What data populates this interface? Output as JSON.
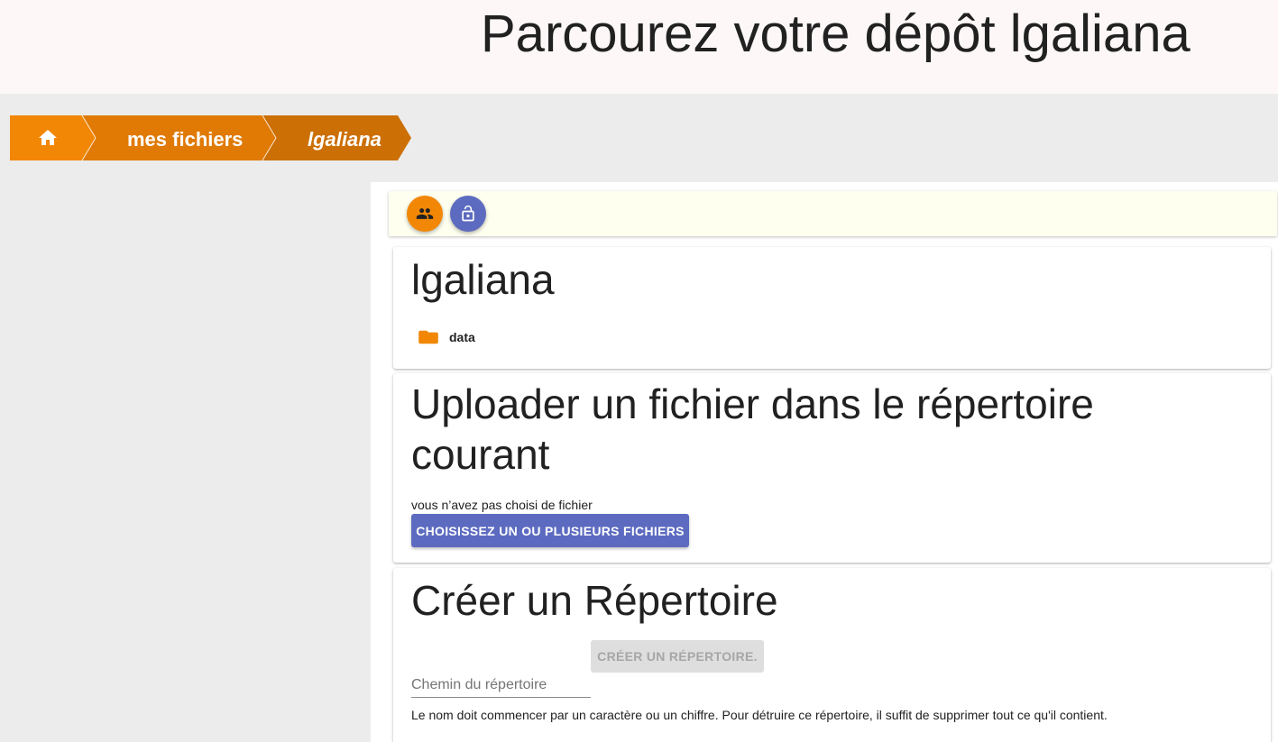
{
  "header": {
    "title": "Parcourez votre dépôt lgaliana"
  },
  "breadcrumb": {
    "home_icon": "home-icon",
    "items": [
      "mes fichiers",
      "lgaliana"
    ],
    "colors": [
      "#f28705",
      "#e07a05",
      "#cc6f04"
    ]
  },
  "toolbar": {
    "buttons": [
      {
        "icon": "people-icon",
        "color": "#f28705"
      },
      {
        "icon": "lock-open-icon",
        "color": "#5c6bc0"
      }
    ]
  },
  "repo": {
    "title": "lgaliana",
    "folders": [
      {
        "name": "data",
        "icon": "folder-icon",
        "color": "#f28705"
      }
    ]
  },
  "upload": {
    "title": "Uploader un fichier dans le répertoire courant",
    "status": "vous n’avez pas choisi de fichier",
    "button_label": "CHOISISSEZ UN OU PLUSIEURS FICHIERS"
  },
  "create_dir": {
    "title": "Créer un Répertoire",
    "button_label": "CRÉER UN RÉPERTOIRE.",
    "input_value": "",
    "input_placeholder": "Chemin du répertoire",
    "help": "Le nom doit commencer par un caractère ou un chiffre. Pour détruire ce répertoire, il suffit de supprimer tout ce qu'il contient."
  }
}
